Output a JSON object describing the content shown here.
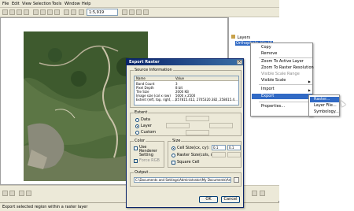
{
  "menubar": {
    "items": [
      "File",
      "Edit",
      "View",
      "Selection",
      "Tools",
      "Window",
      "Help"
    ]
  },
  "toolbar": {
    "scale": "1:5,919"
  },
  "toc": {
    "layers_label": "Layers",
    "layer_name": "Orthophoto_tile.tif"
  },
  "statusbar": {
    "text": "Export selected region within a raster layer"
  },
  "dialog": {
    "title": "Export Raster",
    "source_label": "Source Information",
    "columns": [
      "Name",
      "Value"
    ],
    "rows": [
      [
        "Band Count",
        "3"
      ],
      [
        "Pixel Depth",
        "8 bit"
      ],
      [
        "Tile Size",
        "2000 KB"
      ],
      [
        "Image size (col x row)",
        "5000 x 2500"
      ],
      [
        "Extent (left, top, right, ...)",
        "257815.412, 2705320.382, 258615.4..."
      ]
    ],
    "extent_label": "Extent",
    "extent_options": [
      "Data",
      "Layer",
      "Custom"
    ],
    "color_label": "Color",
    "use_renderer": "Use Renderer Setting",
    "force_rgb": "Force RGB",
    "size_label": "Size",
    "cell_size": "Cell Size(cx, cy):",
    "cell_cx": "0.1",
    "cell_cy": "0.1",
    "raster_size": "Raster Size(cols, rows):",
    "square_cell": "Square Cell",
    "output_label": "Output",
    "output_path": "C:\\Documents and Settings\\Administrator\\My Documents\\ArcGIS\\Default.gdb\\ortho_tile.tif",
    "ok": "OK",
    "cancel": "Cancel"
  },
  "context_menu": {
    "items": [
      {
        "label": "Copy",
        "state": "normal"
      },
      {
        "label": "Remove",
        "state": "normal"
      },
      {
        "label": "Zoom To Active Layer",
        "state": "normal"
      },
      {
        "label": "Zoom To Raster Resolution",
        "state": "normal"
      },
      {
        "label": "Visible Scale Range",
        "state": "dim"
      },
      {
        "label": "Visible Scale",
        "state": "normal"
      },
      {
        "label": "Import",
        "state": "normal"
      },
      {
        "label": "Export",
        "state": "highlight"
      },
      {
        "label": "Properties...",
        "state": "normal"
      }
    ]
  },
  "submenu": {
    "items": [
      {
        "label": "Raster...",
        "state": "highlight"
      },
      {
        "label": "Layer File...",
        "state": "normal"
      },
      {
        "label": "Symbology...",
        "state": "normal"
      }
    ]
  }
}
